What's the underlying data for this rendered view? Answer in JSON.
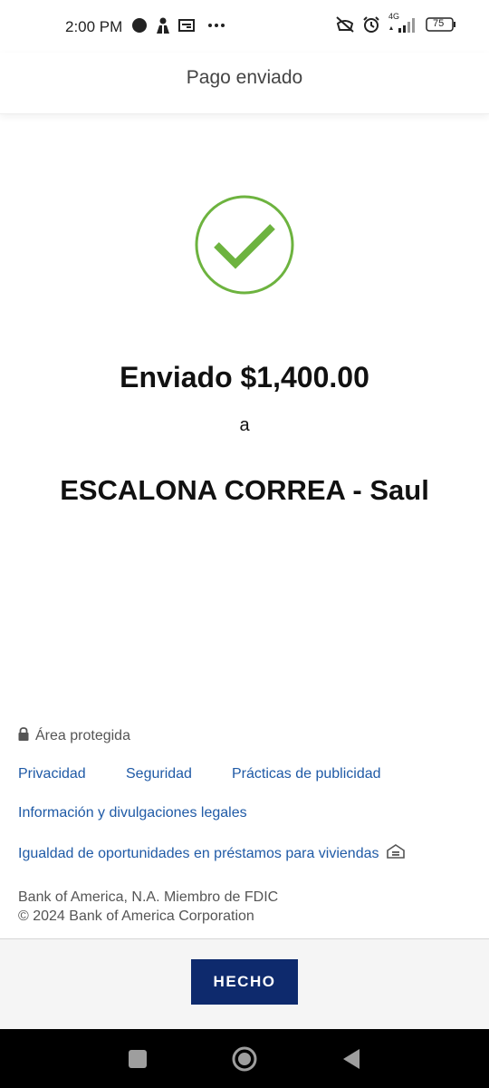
{
  "status_bar": {
    "time": "2:00 PM",
    "network": "4G",
    "battery": "75",
    "left_icons": [
      "circle-icon",
      "person-icon",
      "card-icon",
      "more-icon"
    ],
    "right_icons": [
      "mute-icon",
      "alarm-icon",
      "signal-icon",
      "battery-icon"
    ]
  },
  "header": {
    "title": "Pago enviado"
  },
  "confirmation": {
    "icon": "check-circle-icon",
    "accent_color": "#6db33f",
    "amount_line": "Enviado $1,400.00",
    "to_word": "a",
    "recipient": "ESCALONA CORREA - Saul"
  },
  "footer": {
    "secure_label": "Área protegida",
    "links": {
      "privacy": "Privacidad",
      "security": "Seguridad",
      "advertising": "Prácticas de publicidad",
      "legal_info": "Información y divulgaciones legales",
      "equal_housing": "Igualdad de oportunidades en préstamos para viviendas"
    },
    "legal_line1": "Bank of America, N.A. Miembro de FDIC",
    "legal_line2": "© 2024 Bank of America Corporation"
  },
  "actions": {
    "done_label": "HECHO",
    "button_color": "#0e2a6d"
  },
  "nav": {
    "icons": [
      "recents-icon",
      "home-icon",
      "back-icon"
    ]
  }
}
